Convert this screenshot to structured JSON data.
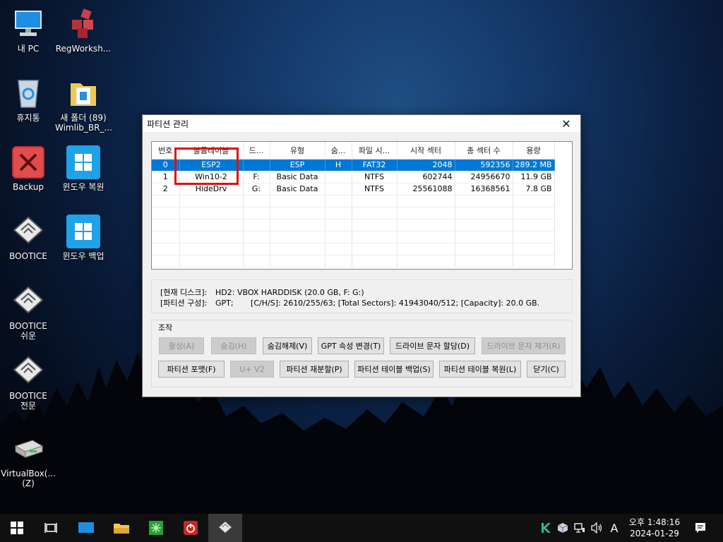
{
  "desktop": {
    "icons": [
      {
        "name": "this-pc",
        "label": "내 PC"
      },
      {
        "name": "regworkshop",
        "label": "RegWorksh..."
      },
      {
        "name": "recycle-bin",
        "label": "휴지통"
      },
      {
        "name": "new-folder",
        "label": "새 폴더 (89)\nWimlib_BR_..."
      },
      {
        "name": "backup",
        "label": "Backup"
      },
      {
        "name": "windows-restore",
        "label": "윈도우 복원"
      },
      {
        "name": "bootice",
        "label": "BOOTICE"
      },
      {
        "name": "windows-backup",
        "label": "윈도우 백업"
      },
      {
        "name": "bootice-easy",
        "label": "BOOTICE\n쉬운"
      },
      {
        "name": "bootice-pro",
        "label": "BOOTICE\n전문"
      },
      {
        "name": "virtualbox",
        "label": "VirtualBox(...\n(Z)"
      }
    ]
  },
  "window": {
    "title": "파티션 관리",
    "close_glyph": "✕",
    "columns": [
      "번호",
      "볼륨레이블",
      "드...",
      "유형",
      "숨...",
      "파일 시...",
      "시작 섹터",
      "총 섹터 수",
      "용량"
    ],
    "rows": [
      {
        "no": "0",
        "label": "ESP2",
        "drive": "",
        "type": "ESP",
        "hidden": "H",
        "fs": "FAT32",
        "start": "2048",
        "total": "592356",
        "size": "289.2 MB"
      },
      {
        "no": "1",
        "label": "Win10-2",
        "drive": "F:",
        "type": "Basic Data",
        "hidden": "",
        "fs": "NTFS",
        "start": "602744",
        "total": "24956670",
        "size": "11.9 GB"
      },
      {
        "no": "2",
        "label": "HideDrv",
        "drive": "G:",
        "type": "Basic Data",
        "hidden": "",
        "fs": "NTFS",
        "start": "25561088",
        "total": "16368561",
        "size": "7.8 GB"
      }
    ],
    "info": {
      "current_disk_key": "[현재 디스크]:",
      "current_disk_val": "HD2: VBOX HARDDISK (20.0 GB, F: G:)",
      "partition_key": "[파티션 구성]:",
      "partition_val": "GPT;       [C/H/S]: 2610/255/63; [Total Sectors]: 41943040/512; [Capacity]: 20.0 GB."
    },
    "ops_caption": "조작",
    "buttons": {
      "activate": "활성(A)",
      "hide": "숨김(H)",
      "unhide": "숨김해제(V)",
      "gpt_attr": "GPT 속성 변경(T)",
      "assign_letter": "드라이브 문자 할당(D)",
      "remove_letter": "드라이브 문자 제거(R)",
      "format": "파티션 포맷(F)",
      "uv2": "U+ V2",
      "repartition": "파티션 재분할(P)",
      "backup_table": "파티션 테이블 백업(S)",
      "restore_table": "파티션 테이블 복원(L)",
      "close": "닫기(C)"
    }
  },
  "taskbar": {
    "tray_ime": "A",
    "time": "오후 1:48:16",
    "date": "2024-01-29"
  }
}
